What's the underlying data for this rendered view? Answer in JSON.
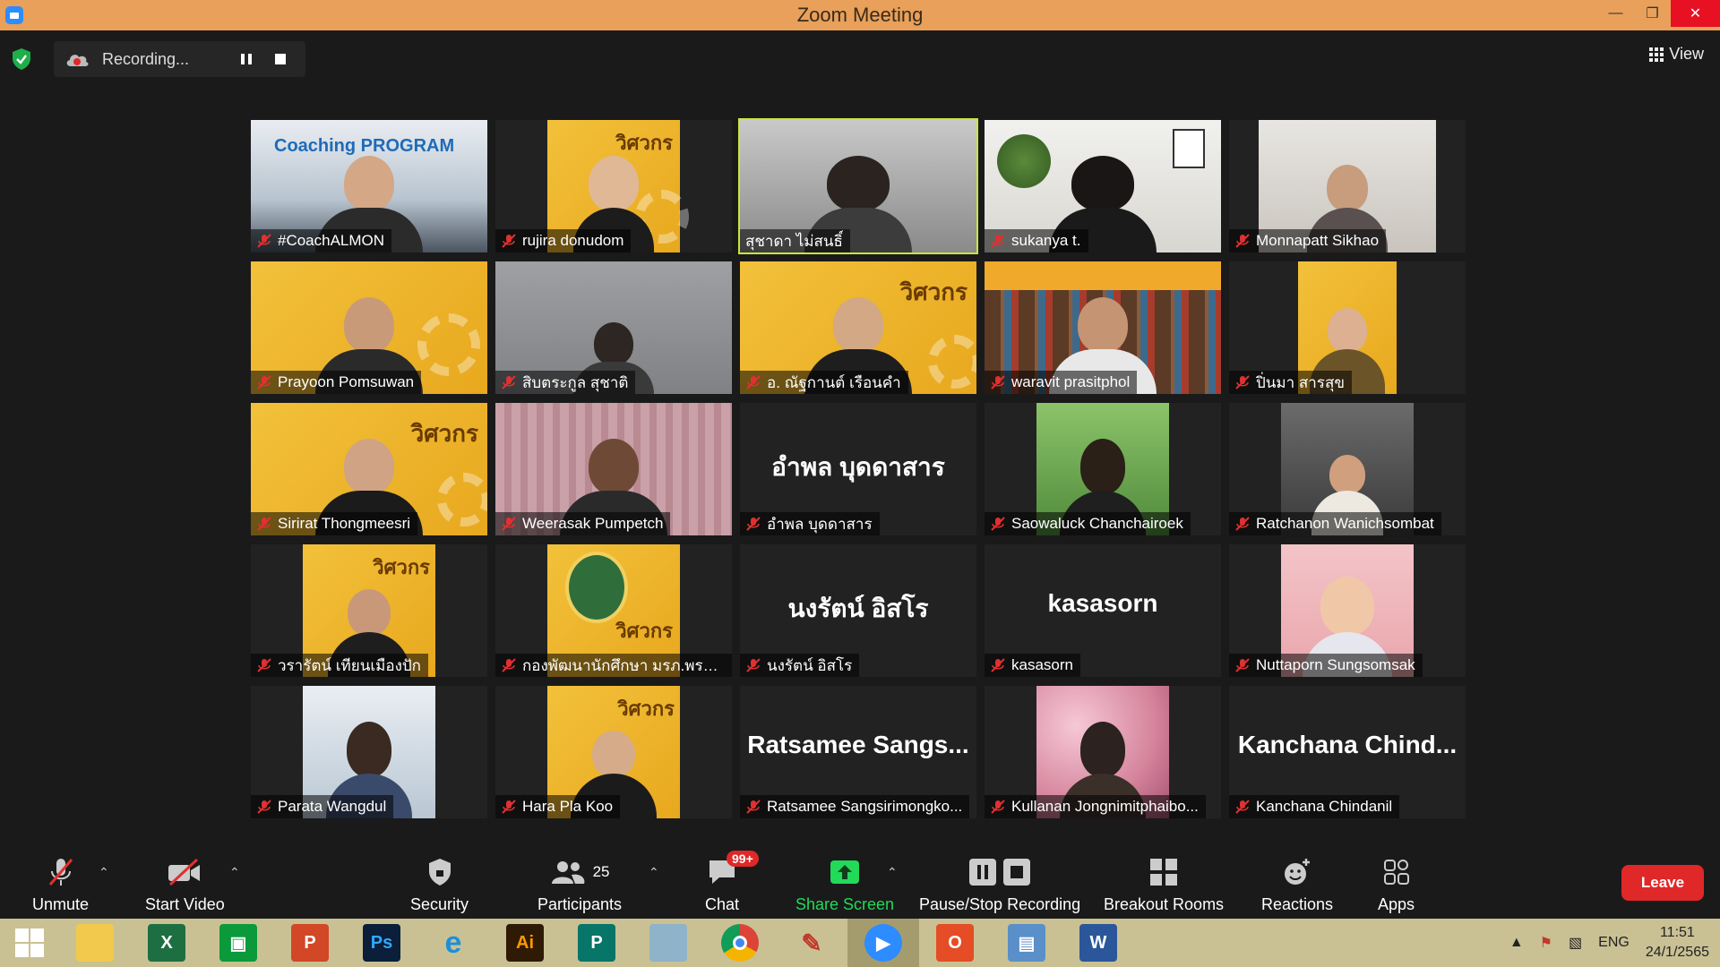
{
  "window": {
    "title": "Zoom Meeting"
  },
  "recording": {
    "status": "Recording..."
  },
  "view": {
    "label": "View"
  },
  "participants": [
    {
      "name": "#CoachALMON",
      "type": "video"
    },
    {
      "name": "rujira donudom",
      "type": "video"
    },
    {
      "name": "สุชาดา ไม่สนธิ์",
      "type": "video",
      "active": true
    },
    {
      "name": "sukanya t.",
      "type": "video"
    },
    {
      "name": "Monnapatt Sikhao",
      "type": "video"
    },
    {
      "name": "Prayoon Pomsuwan",
      "type": "video"
    },
    {
      "name": "สิบตระกูล สุชาติ",
      "type": "video"
    },
    {
      "name": "อ. ณัฐกานต์ เรือนคำ",
      "type": "video"
    },
    {
      "name": "waravit prasitphol",
      "type": "video"
    },
    {
      "name": "ปิ่นมา สารสุข",
      "type": "video"
    },
    {
      "name": "Sirirat Thongmeesri",
      "type": "video"
    },
    {
      "name": "Weerasak Pumpetch",
      "type": "video"
    },
    {
      "name": "อำพล บุดดาสาร",
      "type": "name",
      "display": "อำพล บุดดาสาร"
    },
    {
      "name": "Saowaluck Chanchairoek",
      "type": "video"
    },
    {
      "name": "Ratchanon Wanichsombat",
      "type": "video"
    },
    {
      "name": "วรารัตน์ เทียนเมืองปัก",
      "type": "video"
    },
    {
      "name": "กองพัฒนานักศึกษา มรภ.พระนคร",
      "type": "video"
    },
    {
      "name": "นงรัตน์ อิสโร",
      "type": "name",
      "display": "นงรัตน์ อิสโร"
    },
    {
      "name": "kasasorn",
      "type": "name",
      "display": "kasasorn"
    },
    {
      "name": "Nuttaporn Sungsomsak",
      "type": "video"
    },
    {
      "name": "Parata Wangdul",
      "type": "video"
    },
    {
      "name": "Hara Pla Koo",
      "type": "video"
    },
    {
      "name": "Ratsamee Sangsirimongko...",
      "type": "name",
      "display": "Ratsamee Sangs..."
    },
    {
      "name": "Kullanan Jongnimitphaibo...",
      "type": "video"
    },
    {
      "name": "Kanchana Chindanil",
      "type": "name",
      "display": "Kanchana Chind..."
    }
  ],
  "toolbar": {
    "unmute": "Unmute",
    "start_video": "Start Video",
    "security": "Security",
    "participants": "Participants",
    "participants_count": "25",
    "chat": "Chat",
    "chat_badge": "99+",
    "share_screen": "Share Screen",
    "pause_stop": "Pause/Stop Recording",
    "breakout": "Breakout Rooms",
    "reactions": "Reactions",
    "apps": "Apps",
    "leave": "Leave"
  },
  "taskbar": {
    "apps": [
      "Start",
      "File Explorer",
      "Excel",
      "Store",
      "PowerPoint",
      "Photoshop",
      "Internet Explorer",
      "Illustrator",
      "Publisher",
      "Notes",
      "Chrome",
      "Paint",
      "Zoom",
      "Office",
      "Control Panel",
      "Word"
    ],
    "language": "ENG",
    "time": "11:51",
    "date": "24/1/2565"
  },
  "colors": {
    "titlebar": "#e8a05a",
    "share_green": "#23d959",
    "leave_red": "#e02828",
    "active_border": "#c6e83a",
    "taskbar": "#c9c194"
  }
}
